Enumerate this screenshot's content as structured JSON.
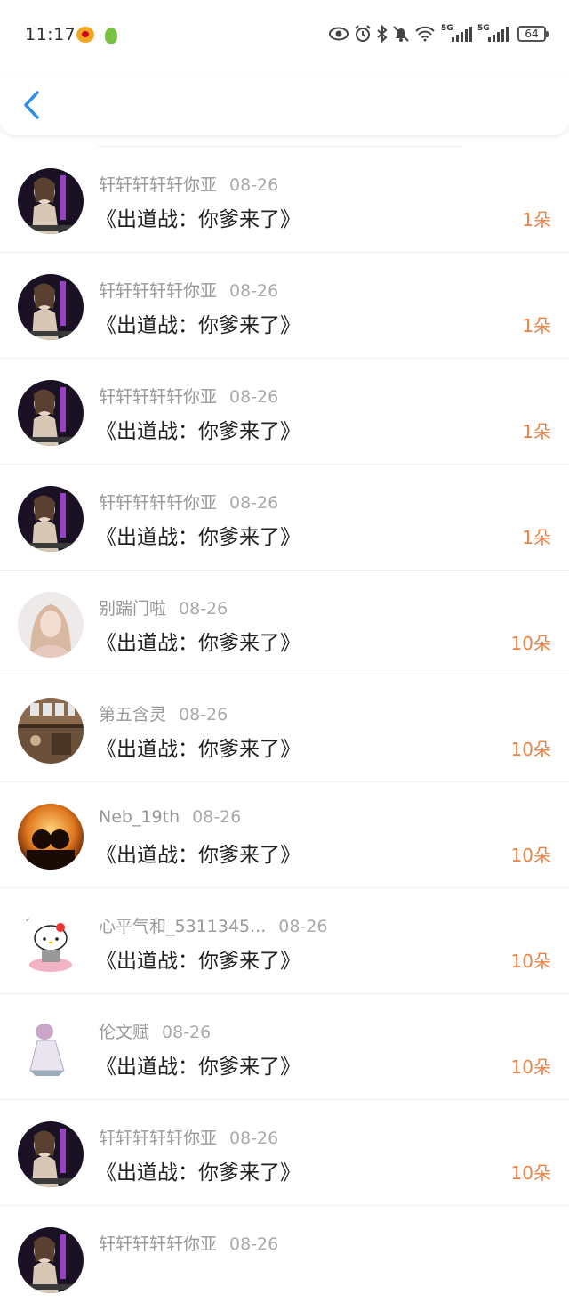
{
  "status_bar": {
    "time": "11:17",
    "battery": "64",
    "net_1": "5G",
    "net_2": "5G"
  },
  "colors": {
    "accent_blue": "#2f8fe6",
    "gift_orange": "#ee8244",
    "meta_grey": "#999999"
  },
  "records": [
    {
      "user": "轩轩轩轩轩你亚",
      "date": "08-26",
      "title": "《出道战：你爹来了》",
      "gift": "1朵",
      "avatar": "avatar-dark"
    },
    {
      "user": "轩轩轩轩轩你亚",
      "date": "08-26",
      "title": "《出道战：你爹来了》",
      "gift": "1朵",
      "avatar": "avatar-dark"
    },
    {
      "user": "轩轩轩轩轩你亚",
      "date": "08-26",
      "title": "《出道战：你爹来了》",
      "gift": "1朵",
      "avatar": "avatar-dark"
    },
    {
      "user": "轩轩轩轩轩你亚",
      "date": "08-26",
      "title": "《出道战：你爹来了》",
      "gift": "1朵",
      "avatar": "avatar-dark"
    },
    {
      "user": "别踹门啦",
      "date": "08-26",
      "title": "《出道战：你爹来了》",
      "gift": "10朵",
      "avatar": "avatar-girl"
    },
    {
      "user": "第五含灵",
      "date": "08-26",
      "title": "《出道战：你爹来了》",
      "gift": "10朵",
      "avatar": "avatar-shelf"
    },
    {
      "user": "Neb_19th",
      "date": "08-26",
      "title": "《出道战：你爹来了》",
      "gift": "10朵",
      "avatar": "avatar-sunset"
    },
    {
      "user": "心平气和_5311345...",
      "date": "08-26",
      "title": "《出道战：你爹来了》",
      "gift": "10朵",
      "avatar": "avatar-kitty"
    },
    {
      "user": "伦文赋",
      "date": "08-26",
      "title": "《出道战：你爹来了》",
      "gift": "10朵",
      "avatar": "avatar-anime"
    },
    {
      "user": "轩轩轩轩轩你亚",
      "date": "08-26",
      "title": "《出道战：你爹来了》",
      "gift": "10朵",
      "avatar": "avatar-dark"
    },
    {
      "user": "轩轩轩轩轩你亚",
      "date": "08-26",
      "title": "",
      "gift": "",
      "avatar": "avatar-dark"
    }
  ]
}
